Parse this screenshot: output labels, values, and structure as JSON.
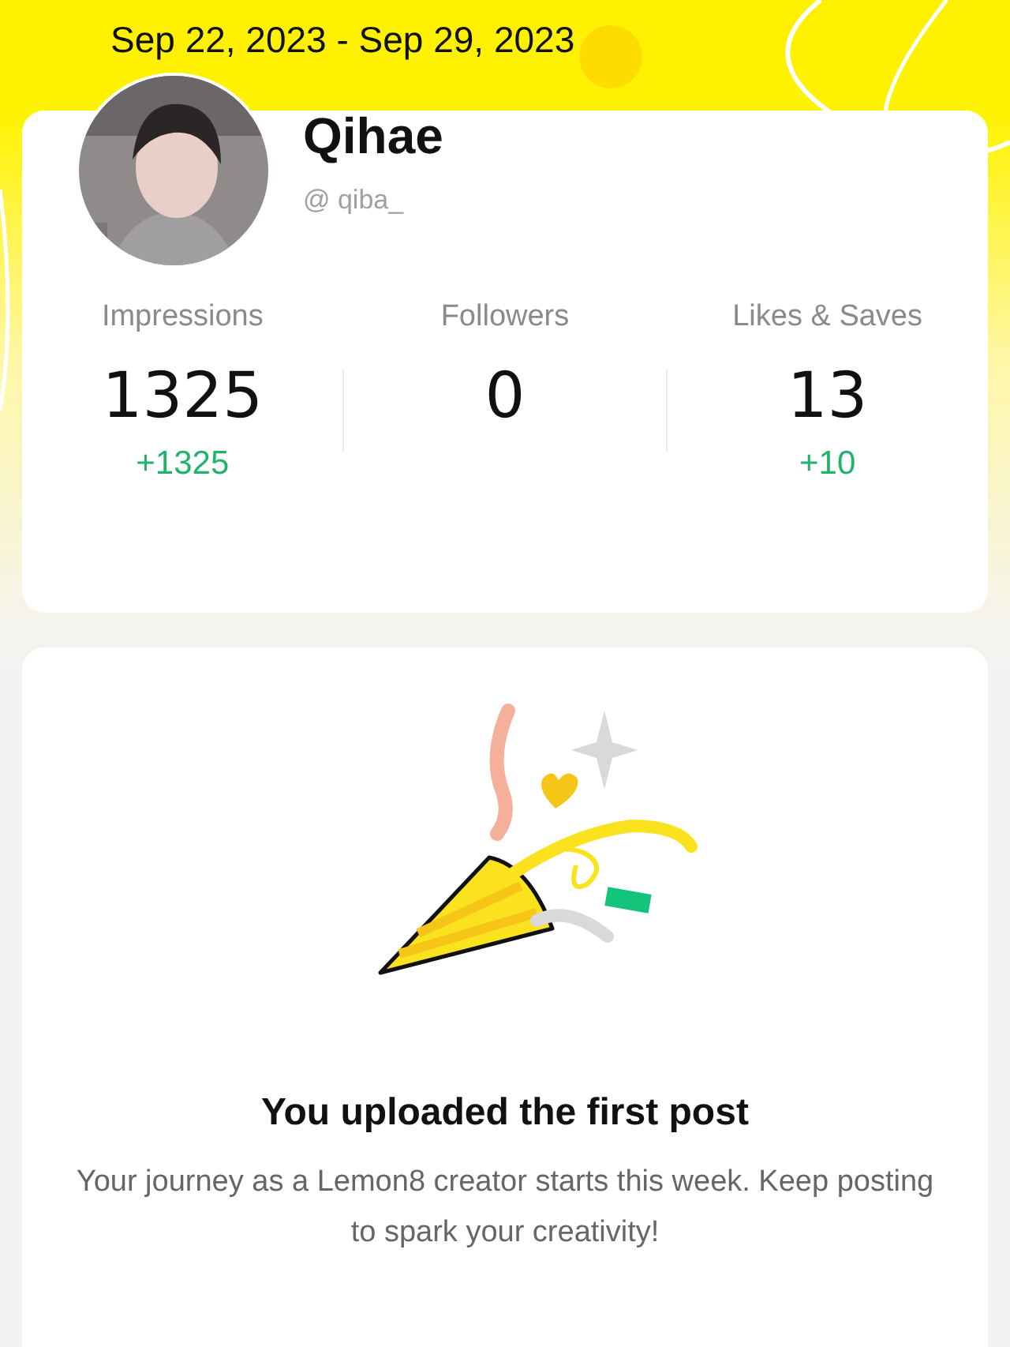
{
  "date_range": "Sep 22, 2023 - Sep 29, 2023",
  "profile": {
    "name": "Qihae",
    "handle": "@ qiba_"
  },
  "stats": [
    {
      "label": "Impressions",
      "value": "1325",
      "delta": "+1325"
    },
    {
      "label": "Followers",
      "value": "0"
    },
    {
      "label": "Likes & Saves",
      "value": "13",
      "delta": "+10"
    }
  ],
  "milestone": {
    "title": "You uploaded the first post",
    "text": "Your journey as a Lemon8 creator starts this week. Keep posting to spark your creativity!"
  }
}
